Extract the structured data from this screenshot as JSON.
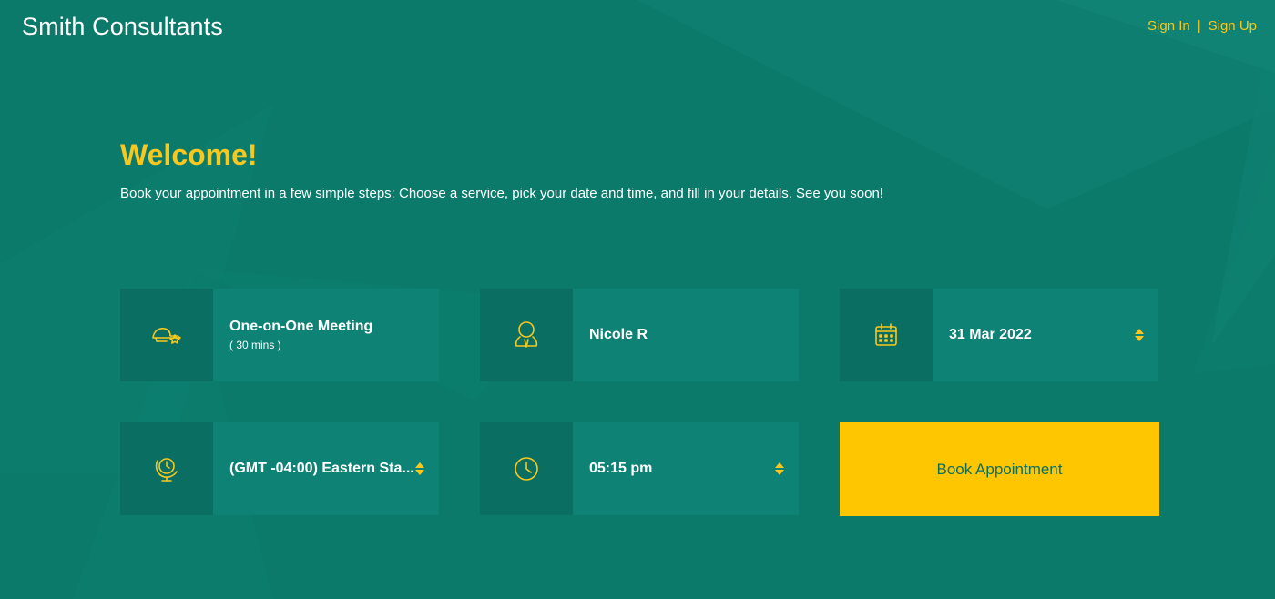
{
  "header": {
    "brand": "Smith Consultants",
    "sign_in": "Sign In",
    "separator": "|",
    "sign_up": "Sign Up"
  },
  "hero": {
    "title": "Welcome!",
    "description": "Book your appointment in a few simple steps: Choose a service, pick your date and time, and fill in your details. See you soon!"
  },
  "form": {
    "service": {
      "icon": "service-icon",
      "name": "One-on-One Meeting",
      "duration": "( 30 mins )"
    },
    "staff": {
      "icon": "person-icon",
      "name": "Nicole R"
    },
    "date": {
      "icon": "calendar-icon",
      "value": "31 Mar 2022"
    },
    "timezone": {
      "icon": "globe-icon",
      "value": "(GMT -04:00) Eastern Sta..."
    },
    "time": {
      "icon": "clock-icon",
      "value": "05:15 pm"
    },
    "submit_label": "Book Appointment"
  },
  "colors": {
    "background": "#0b7a6b",
    "accent": "#f8c81e",
    "button": "#fdc600",
    "icon_tile": "#0a6e62",
    "field": "#0e8275"
  }
}
